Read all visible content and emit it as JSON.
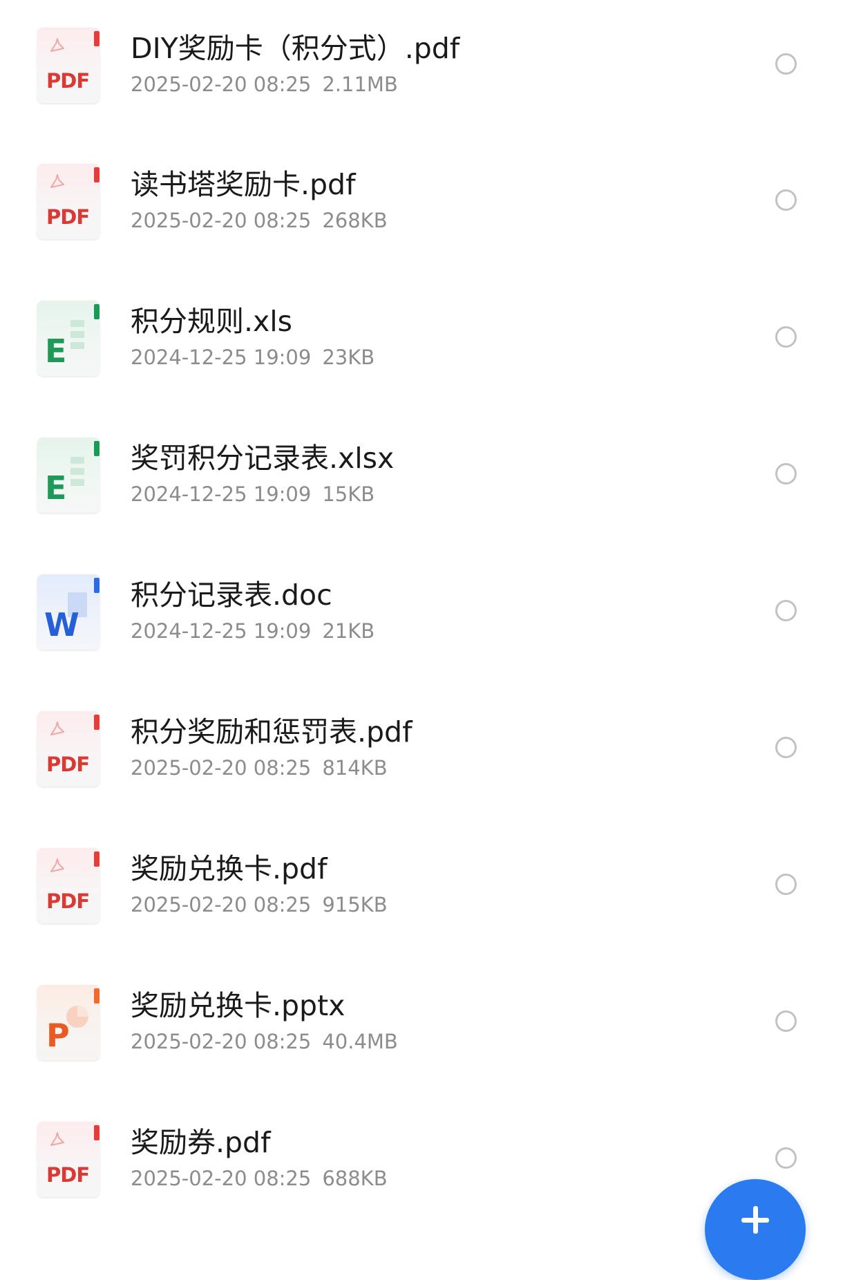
{
  "files": [
    {
      "type": "pdf",
      "icon_label": "PDF",
      "icon": "pdf-file-icon",
      "name": "DIY奖励卡（积分式）.pdf",
      "date": "2025-02-20 08:25",
      "size": "2.11MB"
    },
    {
      "type": "pdf",
      "icon_label": "PDF",
      "icon": "pdf-file-icon",
      "name": "读书塔奖励卡.pdf",
      "date": "2025-02-20 08:25",
      "size": "268KB"
    },
    {
      "type": "xls",
      "icon_label": "E",
      "icon": "excel-file-icon",
      "name": "积分规则.xls",
      "date": "2024-12-25 19:09",
      "size": "23KB"
    },
    {
      "type": "xls",
      "icon_label": "E",
      "icon": "excel-file-icon",
      "name": "奖罚积分记录表.xlsx",
      "date": "2024-12-25 19:09",
      "size": "15KB"
    },
    {
      "type": "doc",
      "icon_label": "W",
      "icon": "word-file-icon",
      "name": "积分记录表.doc",
      "date": "2024-12-25 19:09",
      "size": "21KB"
    },
    {
      "type": "pdf",
      "icon_label": "PDF",
      "icon": "pdf-file-icon",
      "name": "积分奖励和惩罚表.pdf",
      "date": "2025-02-20 08:25",
      "size": "814KB"
    },
    {
      "type": "pdf",
      "icon_label": "PDF",
      "icon": "pdf-file-icon",
      "name": "奖励兑换卡.pdf",
      "date": "2025-02-20 08:25",
      "size": "915KB"
    },
    {
      "type": "ppt",
      "icon_label": "P",
      "icon": "powerpoint-file-icon",
      "name": "奖励兑换卡.pptx",
      "date": "2025-02-20 08:25",
      "size": "40.4MB"
    },
    {
      "type": "pdf",
      "icon_label": "PDF",
      "icon": "pdf-file-icon",
      "name": "奖励券.pdf",
      "date": "2025-02-20 08:25",
      "size": "688KB"
    }
  ],
  "colors": {
    "pdf": "#d93a33",
    "excel": "#1e9a58",
    "word": "#2660d8",
    "powerpoint": "#ea5a23",
    "fab": "#2b7bf0",
    "name_text": "#1a1a1a",
    "meta_text": "#8c8c8c"
  },
  "fab": {
    "icon": "plus-icon"
  }
}
